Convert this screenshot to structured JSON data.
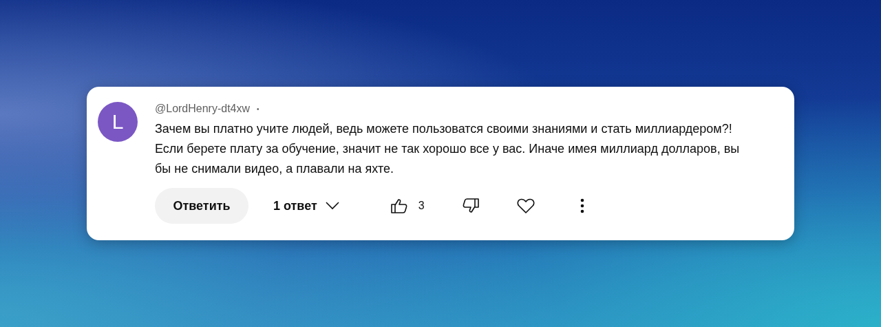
{
  "comment": {
    "avatar_letter": "L",
    "author": "@LordHenry-dt4xw",
    "separator": "•",
    "text": "Зачем вы платно учите людей, ведь можете пользоватся своими знаниями и стать миллиардером?!\nЕсли берете плату за обучение, значит не так хорошо все у вас. Иначе имея миллиард долларов, вы\nбы не снимали видео, а плавали на яхте.",
    "reply_button": "Ответить",
    "replies_toggle": "1 ответ",
    "like_count": "3"
  }
}
